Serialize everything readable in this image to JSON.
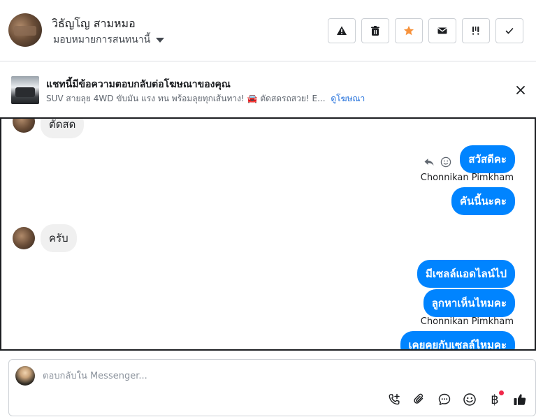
{
  "header": {
    "contact_name": "วิธัญโญ สามหมอ",
    "assign_label": "มอบหมายการสนทนานี้",
    "actions": [
      {
        "name": "alert-button",
        "icon": "warning-icon"
      },
      {
        "name": "delete-button",
        "icon": "trash-icon"
      },
      {
        "name": "star-button",
        "icon": "star-icon",
        "color": "#f7923b"
      },
      {
        "name": "mark-unread-button",
        "icon": "envelope-icon"
      },
      {
        "name": "follow-up-button",
        "icon": "follow-up-icon"
      },
      {
        "name": "mark-done-button",
        "icon": "checkmark-icon"
      }
    ]
  },
  "ad_banner": {
    "title": "แชทนี้มีข้อความตอบกลับต่อโฆษณาของคุณ",
    "subtitle": "SUV สายลุย 4WD ขับมัน แรง ทน พร้อมลุยทุกเส้นทาง! 🚘 ตัดสดรถสวย! E...",
    "link": "ดูโฆษณา"
  },
  "conversation": {
    "messages": [
      {
        "direction": "in",
        "text": "ตัดสด"
      },
      {
        "direction": "out",
        "text": "สวัสดีคะ"
      },
      {
        "direction": "out",
        "sender": "Chonnikan Pimkham",
        "text": "คันนี้นะคะ"
      },
      {
        "direction": "in",
        "text": "ครับ"
      },
      {
        "direction": "out",
        "text": "มีเซลล์แอดไลน์ไป"
      },
      {
        "direction": "out",
        "text": "ลูกหาเห็นไหมคะ"
      },
      {
        "direction": "out",
        "sender": "Chonnikan Pimkham",
        "text": "เคยคุยกับเซลล์ไหมคะ"
      }
    ]
  },
  "composer": {
    "placeholder": "ตอบกลับใน Messenger...",
    "tools": [
      "call-add-icon",
      "paperclip-icon",
      "chat-bubble-icon",
      "emoji-icon",
      "baht-icon",
      "thumbs-up-icon"
    ],
    "baht_symbol": "฿"
  },
  "colors": {
    "accent": "#0084ff",
    "link": "#216fdb",
    "star": "#f7923b",
    "notification_dot": "#f02849"
  }
}
